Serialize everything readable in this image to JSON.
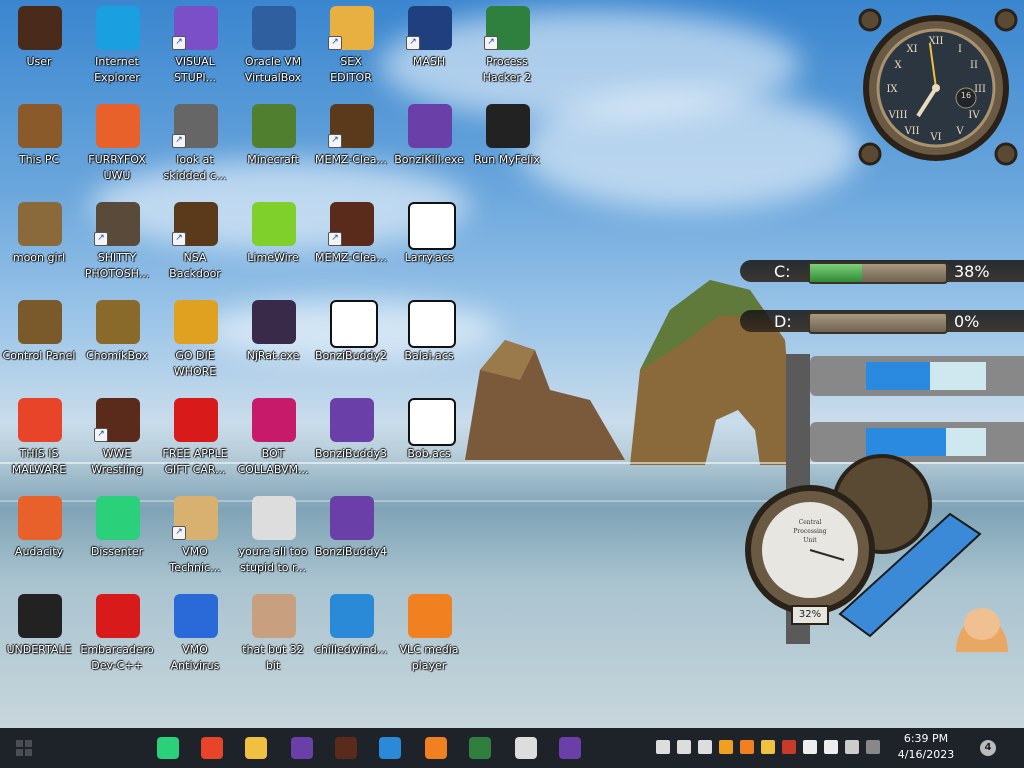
{
  "desktop_icons": [
    {
      "label": "User",
      "icon": "user-folder-icon",
      "color": "#4a2a1a",
      "shortcut": false
    },
    {
      "label": "Internet\nExplorer",
      "icon": "edge-icon",
      "color": "#1aa0e0",
      "shortcut": false
    },
    {
      "label": "VISUAL\nSTUPI...",
      "icon": "visual-studio-icon",
      "color": "#7a4fc8",
      "shortcut": true
    },
    {
      "label": "Oracle VM\nVirtualBox",
      "icon": "virtualbox-icon",
      "color": "#2f5f9f",
      "shortcut": false
    },
    {
      "label": "SEX\nEDITOR",
      "icon": "hex-editor-icon",
      "color": "#e8b040",
      "shortcut": true
    },
    {
      "label": "MASH",
      "icon": "hat-icon",
      "color": "#1f3f7f",
      "shortcut": true
    },
    {
      "label": "Process\nHacker 2",
      "icon": "process-hacker-icon",
      "color": "#2f7f3f",
      "shortcut": true
    },
    {
      "label": "This PC",
      "icon": "computer-icon",
      "color": "#8a5a2a",
      "shortcut": false
    },
    {
      "label": "FURRYFOX\nUWU",
      "icon": "firefox-icon",
      "color": "#e8602a",
      "shortcut": false
    },
    {
      "label": "look at\nskidded c...",
      "icon": "stacked-windows-icon",
      "color": "#666666",
      "shortcut": true
    },
    {
      "label": "Minecraft",
      "icon": "minecraft-icon",
      "color": "#4f7f2f",
      "shortcut": false
    },
    {
      "label": "MEMZ-Clea...",
      "icon": "memz-icon",
      "color": "#5a3a1a",
      "shortcut": true
    },
    {
      "label": "BonziKill.exe",
      "icon": "bonzi-icon",
      "color": "#6a3fa8",
      "shortcut": false
    },
    {
      "label": "Run MyFelix",
      "icon": "cat-icon",
      "color": "#222222",
      "shortcut": false
    },
    {
      "label": "moon girl",
      "icon": "steampunk-folder-icon",
      "color": "#8a6a3a",
      "shortcut": false
    },
    {
      "label": "SHITTY\nPHOTOSH...",
      "icon": "gimp-icon",
      "color": "#5a4a3a",
      "shortcut": true
    },
    {
      "label": "NSA\nBackdoor",
      "icon": "steampunk-box-icon",
      "color": "#5a3a1a",
      "shortcut": true
    },
    {
      "label": "LimeWire",
      "icon": "limewire-icon",
      "color": "#7fd02a",
      "shortcut": false
    },
    {
      "label": "MEMZ-Clea...",
      "icon": "memz-icon",
      "color": "#5a2a1a",
      "shortcut": true
    },
    {
      "label": "Larry.acs",
      "icon": "7z-archive-icon",
      "color": "#ffffff",
      "shortcut": false
    },
    {
      "label": "Control Panel",
      "icon": "lightbulb-icon",
      "color": "#7a5a2a",
      "shortcut": false
    },
    {
      "label": "ChomikBox",
      "icon": "chomikbox-icon",
      "color": "#8a6a2a",
      "shortcut": false
    },
    {
      "label": "GO DIE\nWHORE",
      "icon": "de-icon",
      "color": "#e0a020",
      "shortcut": false
    },
    {
      "label": "NjRat.exe",
      "icon": "skull-icon",
      "color": "#3a2a4a",
      "shortcut": false
    },
    {
      "label": "BonziBuddy2",
      "icon": "flag-file-icon",
      "color": "#ffffff",
      "shortcut": false
    },
    {
      "label": "Balai.acs",
      "icon": "7z-archive-icon",
      "color": "#ffffff",
      "shortcut": false
    },
    {
      "label": "THIS IS\nMALWARE",
      "icon": "chrome-icon",
      "color": "#e8442a",
      "shortcut": false
    },
    {
      "label": "WWE\nWrestling",
      "icon": "memz-icon",
      "color": "#5a2a1a",
      "shortcut": true
    },
    {
      "label": "FREE APPLE\nGIFT CAR...",
      "icon": "apple-icon",
      "color": "#d81a1a",
      "shortcut": false
    },
    {
      "label": "BOT\nCOLLABVM...",
      "icon": "monitor-icon",
      "color": "#c81a6a",
      "shortcut": false
    },
    {
      "label": "BonziBuddy3",
      "icon": "bonzi-icon",
      "color": "#6a3fa8",
      "shortcut": false
    },
    {
      "label": "Bob.acs",
      "icon": "7z-archive-icon",
      "color": "#ffffff",
      "shortcut": false
    },
    {
      "label": "Audacity",
      "icon": "audacity-icon",
      "color": "#e8602a",
      "shortcut": false
    },
    {
      "label": "Dissenter",
      "icon": "dissenter-icon",
      "color": "#2ad07a",
      "shortcut": false
    },
    {
      "label": "VMO\nTechnic...",
      "icon": "doctor-icon",
      "color": "#d8b070",
      "shortcut": true
    },
    {
      "label": "youre all too\nstupid to r...",
      "icon": "portrait-icon",
      "color": "#dddddd",
      "shortcut": false
    },
    {
      "label": "BonziBuddy4",
      "icon": "bonzi-icon",
      "color": "#6a3fa8",
      "shortcut": false
    },
    {
      "label": "UNDERTALE",
      "icon": "unity-icon",
      "color": "#222222",
      "shortcut": false
    },
    {
      "label": "Embarcadero\nDev-C++",
      "icon": "devcpp-icon",
      "color": "#d81a1a",
      "shortcut": false
    },
    {
      "label": "VMO\nAntivirus",
      "icon": "shield-icon",
      "color": "#2a6ad8",
      "shortcut": false
    },
    {
      "label": "that but 32\nbit",
      "icon": "portrait-icon",
      "color": "#c8a080",
      "shortcut": false
    },
    {
      "label": "chilledwind...",
      "icon": "windows-xp-icon",
      "color": "#2a8ad8",
      "shortcut": false
    },
    {
      "label": "VLC media\nplayer",
      "icon": "vlc-icon",
      "color": "#f08020",
      "shortcut": false
    }
  ],
  "clock": {
    "day": "16"
  },
  "drives": [
    {
      "letter": "C:",
      "percent_text": "38%",
      "fill": 0.38
    },
    {
      "letter": "D:",
      "percent_text": "0%",
      "fill": 0.0
    }
  ],
  "cpu_gauge": {
    "title": "Central\nProcessing\nUnit",
    "percent_text": "32%"
  },
  "taskbar": {
    "start_icon": "windows-start-icon",
    "pinned": [
      {
        "icon": "dissenter-icon",
        "color": "#2ad07a"
      },
      {
        "icon": "chrome-icon",
        "color": "#e8442a"
      },
      {
        "icon": "file-explorer-icon",
        "color": "#f0c040"
      },
      {
        "icon": "bonzi-icon",
        "color": "#6a3fa8"
      },
      {
        "icon": "memz-icon",
        "color": "#5a2a1a"
      },
      {
        "icon": "windows-xp-icon",
        "color": "#2a8ad8"
      },
      {
        "icon": "vlc-icon",
        "color": "#f08020"
      },
      {
        "icon": "process-hacker-icon",
        "color": "#2f7f3f"
      },
      {
        "icon": "cat-icon",
        "color": "#dddddd"
      },
      {
        "icon": "bonzi-icon",
        "color": "#6a3fa8"
      }
    ],
    "tray_icons": [
      {
        "icon": "cat-tray-icon",
        "color": "#dddddd"
      },
      {
        "icon": "network-icon",
        "color": "#dddddd"
      },
      {
        "icon": "volume-muted-icon",
        "color": "#dddddd"
      },
      {
        "icon": "search-tray-icon",
        "color": "#f0a020"
      },
      {
        "icon": "java-icon",
        "color": "#f08020"
      },
      {
        "icon": "hat-tray-icon",
        "color": "#f0c040"
      },
      {
        "icon": "bottle-icon",
        "color": "#c83a2a"
      },
      {
        "icon": "drop-icon",
        "color": "#eeeeee"
      },
      {
        "icon": "onedrive-icon",
        "color": "#eeeeee"
      },
      {
        "icon": "qr-icon",
        "color": "#cccccc"
      },
      {
        "icon": "pen-icon",
        "color": "#888888"
      }
    ],
    "time": "6:39 PM",
    "date": "4/16/2023",
    "notification_count": "4"
  }
}
